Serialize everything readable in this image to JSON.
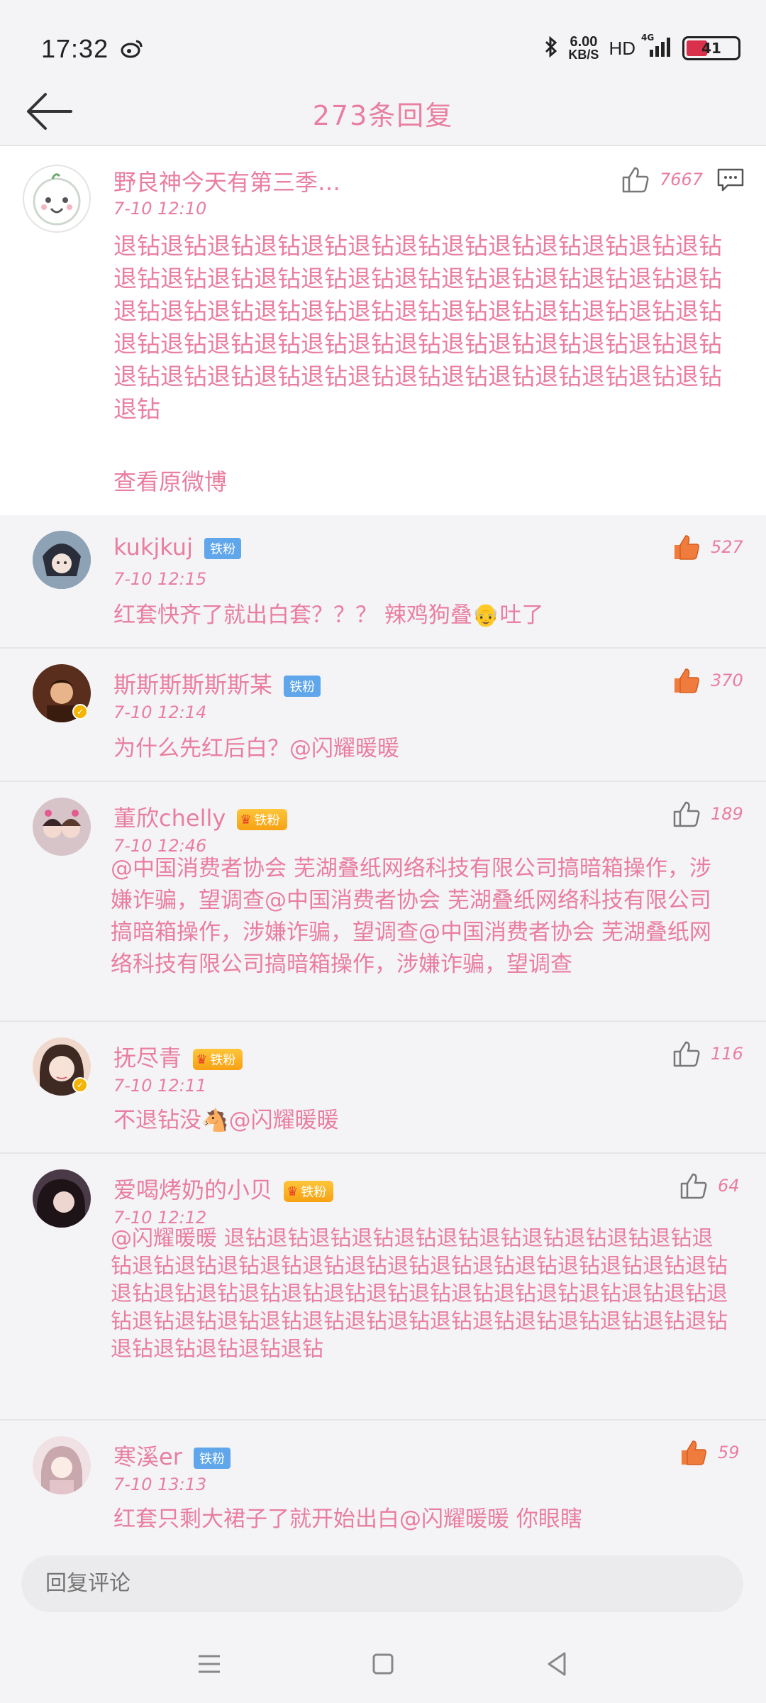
{
  "status_bar": {
    "time": "17:32",
    "speed_value": "6.00",
    "speed_unit": "KB/S",
    "hd": "HD",
    "network": "4G",
    "battery": "41"
  },
  "header": {
    "title": "273条回复"
  },
  "main_post": {
    "username": "野良神今天有第三季…",
    "time": "7-10 12:10",
    "likes": "7667",
    "text": "退钻退钻退钻退钻退钻退钻退钻退钻退钻退钻退钻退钻退钻退钻退钻退钻退钻退钻退钻退钻退钻退钻退钻退钻退钻退钻退钻退钻退钻退钻退钻退钻退钻退钻退钻退钻退钻退钻退钻退钻退钻退钻退钻退钻退钻退钻退钻退钻退钻退钻退钻退钻退钻退钻退钻退钻退钻退钻退钻退钻退钻退钻退钻退钻退钻退钻",
    "view_original": "查看原微博"
  },
  "comments": [
    {
      "username": "kukjkuj",
      "badge": "铁粉",
      "time": "7-10 12:15",
      "likes": "527",
      "text": "红套快齐了就出白套？？？ 辣鸡狗叠👴吐了"
    },
    {
      "username": "斯斯斯斯斯斯某",
      "badge": "铁粉",
      "time": "7-10 12:14",
      "likes": "370",
      "text": "为什么先红后白？@闪耀暖暖"
    },
    {
      "username": "董欣chelly",
      "badge": "铁粉",
      "time": "7-10 12:46",
      "likes": "189",
      "text": "@中国消费者协会  芜湖叠纸网络科技有限公司搞暗箱操作，涉嫌诈骗，望调查@中国消费者协会  芜湖叠纸网络科技有限公司搞暗箱操作，涉嫌诈骗，望调查@中国消费者协会  芜湖叠纸网络科技有限公司搞暗箱操作，涉嫌诈骗，望调查"
    },
    {
      "username": "抚尽青",
      "badge": "铁粉",
      "time": "7-10 12:11",
      "likes": "116",
      "text": "不退钻没🐴@闪耀暖暖"
    },
    {
      "username": "爱喝烤奶的小贝",
      "badge": "铁粉",
      "time": "7-10 12:12",
      "likes": "64",
      "text": "@闪耀暖暖 退钻退钻退钻退钻退钻退钻退钻退钻退钻退钻退钻退钻退钻退钻退钻退钻退钻退钻退钻退钻退钻退钻退钻退钻退钻退钻退钻退钻退钻退钻退钻退钻退钻退钻退钻退钻退钻退钻退钻退钻退钻退钻退钻退钻退钻退钻退钻退钻退钻退钻退钻退钻退钻退钻退钻退钻退钻退钻退钻退钻"
    },
    {
      "username": "寒溪er",
      "badge": "铁粉",
      "time": "7-10 13:13",
      "likes": "59",
      "text": "红套只剩大裙子了就开始出白@闪耀暖暖 你眼瞎吗？？？？"
    }
  ],
  "reply_bar": {
    "placeholder": "回复评论"
  },
  "colors": {
    "accent_pink": "#e97ea0",
    "like_active_orange": "#ef7b3c",
    "badge_blue": "#5fa6ea",
    "badge_gold": "#f7a113"
  }
}
